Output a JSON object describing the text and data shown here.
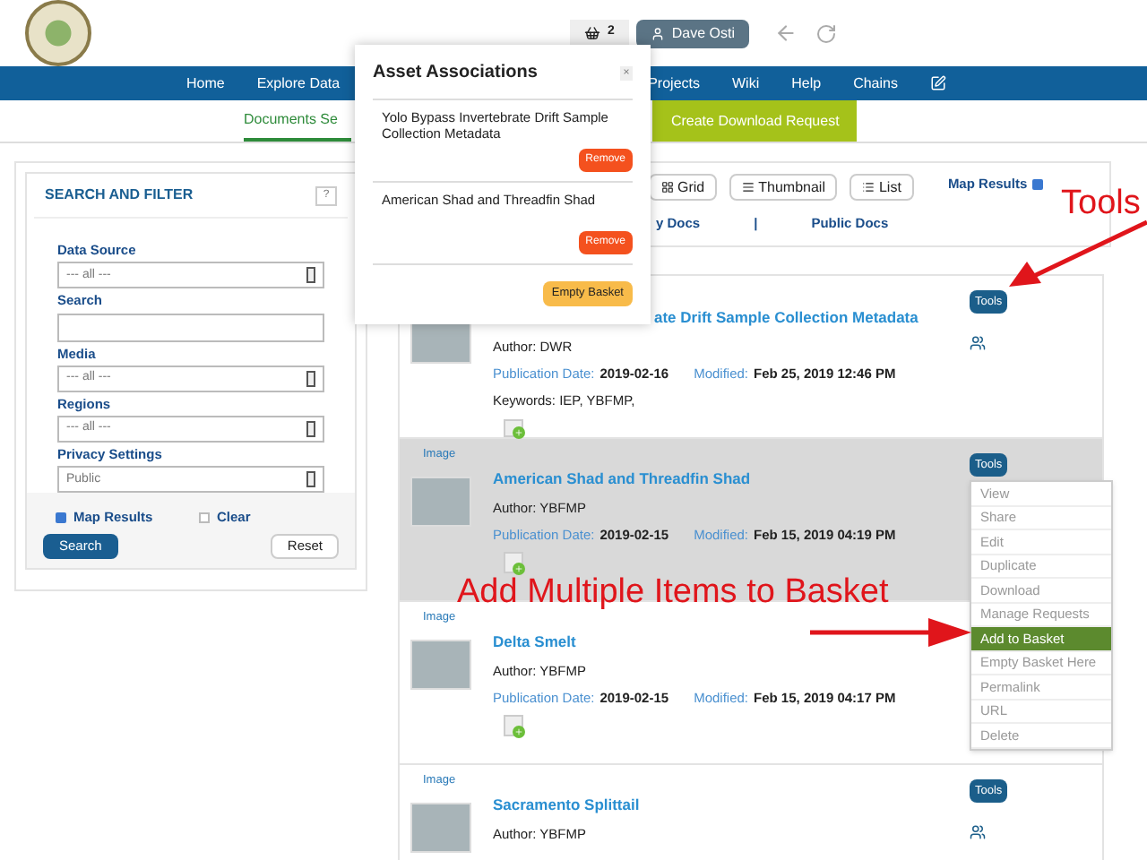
{
  "header": {
    "basket_count": "2",
    "user": "Dave Osti"
  },
  "nav": {
    "left": [
      "Home",
      "Explore Data"
    ],
    "right": [
      "Projects",
      "Wiki",
      "Help",
      "Chains"
    ]
  },
  "subnav": {
    "active_tab": "Documents Se",
    "action": "Create Download Request"
  },
  "filter": {
    "title": "SEARCH AND FILTER",
    "help": "?",
    "fields": [
      {
        "label": "Data Source",
        "kind": "select",
        "value": "--- all ---"
      },
      {
        "label": "Search",
        "kind": "text"
      },
      {
        "label": "Media",
        "kind": "select",
        "value": "--- all ---"
      },
      {
        "label": "Regions",
        "kind": "select",
        "value": "--- all ---"
      },
      {
        "label": "Privacy Settings",
        "kind": "select",
        "value": "Public"
      }
    ],
    "options": [
      {
        "label": "Map Results",
        "checked": true
      },
      {
        "label": "Clear",
        "checked": false
      }
    ],
    "search_button": "Search",
    "reset_button": "Reset"
  },
  "toolbar": {
    "views": [
      "Grid",
      "Thumbnail",
      "List"
    ],
    "map_results": {
      "label": "Map Results",
      "checked": true
    },
    "tabs": [
      "y Docs",
      "|",
      "Public Docs"
    ]
  },
  "results": [
    {
      "title": "ate Drift Sample Collection Metadata",
      "author": "Author: DWR",
      "pub_label": "Publication Date:",
      "pub": "2019-02-16",
      "mod_label": "Modified:",
      "mod": "Feb 25, 2019 12:46 PM",
      "keywords": "Keywords: IEP, YBFMP,",
      "highlighted": false,
      "tools": "Tools",
      "basket_icon": true,
      "share_icon": true
    },
    {
      "type": "Image",
      "title": "American Shad and Threadfin Shad",
      "author": "Author: YBFMP",
      "pub_label": "Publication Date:",
      "pub": "2019-02-15",
      "mod_label": "Modified:",
      "mod": "Feb 15, 2019 04:19 PM",
      "highlighted": true,
      "tools": "Tools",
      "basket_icon": true,
      "share_icon": false
    },
    {
      "type": "Image",
      "title": "Delta Smelt",
      "author": "Author: YBFMP",
      "pub_label": "Publication Date:",
      "pub": "2019-02-15",
      "mod_label": "Modified:",
      "mod": "Feb 15, 2019 04:17 PM",
      "highlighted": false,
      "basket_icon": true,
      "share_icon": false
    },
    {
      "type": "Image",
      "title": "Sacramento Splittail",
      "author": "Author: YBFMP",
      "highlighted": false,
      "tools": "Tools",
      "basket_icon": false,
      "share_icon": true
    }
  ],
  "tools_menu": [
    {
      "label": "View",
      "selected": false
    },
    {
      "label": "Share",
      "selected": false
    },
    {
      "label": "Edit",
      "selected": false
    },
    {
      "label": "Duplicate",
      "selected": false
    },
    {
      "label": "Download",
      "selected": false
    },
    {
      "label": "Manage Requests",
      "selected": false
    },
    {
      "label": "Add to Basket",
      "selected": true
    },
    {
      "label": "Empty Basket Here",
      "selected": false
    },
    {
      "label": "Permalink",
      "selected": false
    },
    {
      "label": "URL",
      "selected": false
    },
    {
      "label": "Delete",
      "selected": false
    }
  ],
  "popup": {
    "title": "Asset Associations",
    "close": "×",
    "items": [
      {
        "name": "Yolo Bypass Invertebrate Drift Sample Collection Metadata",
        "action": "Remove"
      },
      {
        "name": "American Shad and Threadfin Shad",
        "action": "Remove"
      }
    ],
    "empty_button": "Empty Basket"
  },
  "annotations": [
    "Tools",
    "Add Multiple Items to Basket"
  ]
}
